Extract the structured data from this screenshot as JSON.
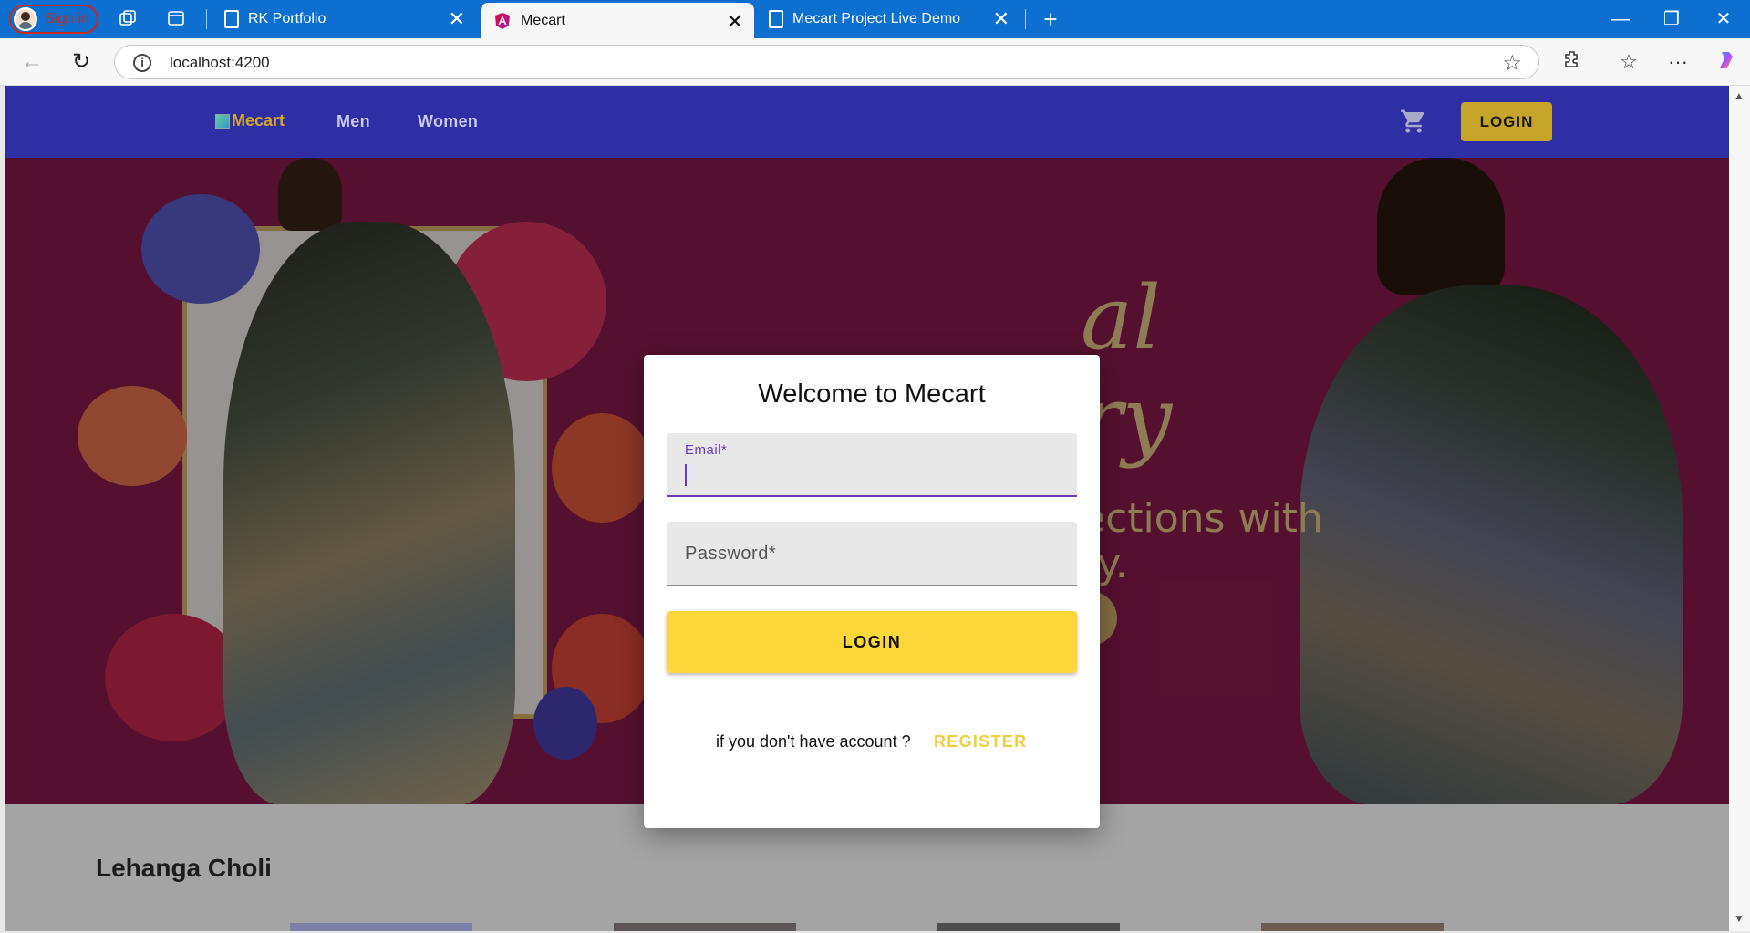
{
  "browser": {
    "profile_label": "Sign in",
    "tabs": [
      {
        "title": "RK Portfolio"
      },
      {
        "title": "Mecart"
      },
      {
        "title": "Mecart Project Live Demo"
      }
    ],
    "url": "localhost:4200",
    "tab_close_glyph": "✕",
    "new_tab_glyph": "+",
    "window_controls": {
      "minimize": "—",
      "restore": "❐",
      "close": "✕"
    },
    "nav": {
      "back": "←",
      "reload": "↻"
    },
    "toolbar_icons": {
      "star": "☆",
      "extensions": "⚙",
      "favorites": "☆",
      "more": "···"
    }
  },
  "site": {
    "brand": "Mecart",
    "nav_links": [
      "Men",
      "Women"
    ],
    "login_button": "LOGIN",
    "hero_text": {
      "line1": "al",
      "line2": "ry",
      "line3": "ections with",
      "line4": "ry."
    },
    "section_title": "Lehanga Choli"
  },
  "modal": {
    "title": "Welcome to Mecart",
    "email_label": "Email*",
    "email_value": "",
    "password_label": "Password*",
    "login_button": "LOGIN",
    "no_account_text": "if you don't have account ?",
    "register_link": "REGISTER"
  },
  "colors": {
    "navbar": "#2f2fa5",
    "accent_gold": "#c7a52a",
    "login_yellow": "#fcd73a",
    "focus_purple": "#6a3ab5",
    "browser_blue": "#0d6fcf"
  }
}
